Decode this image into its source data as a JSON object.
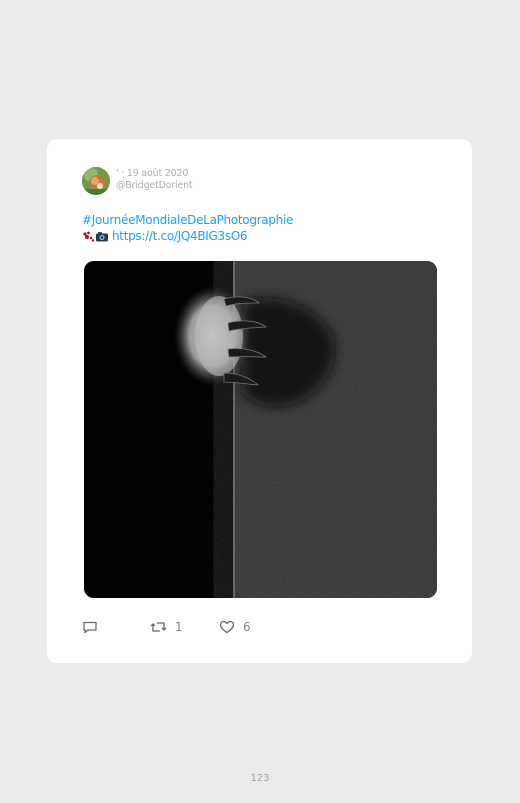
{
  "tweet": {
    "author_name": "'",
    "date": "· 19 août 2020",
    "handle": "@BridgetDorient",
    "hashtag": "#JournéeMondialeDeLaPhotographie",
    "link": "https://t.co/JQ4BIG3sO6",
    "emoji_icons": [
      "paw-prints-icon",
      "camera-icon"
    ],
    "photo_description_icon": "cat-paw-photo"
  },
  "actions": {
    "reply_count": "",
    "retweet_count": "1",
    "like_count": "6"
  },
  "page_number": "123"
}
